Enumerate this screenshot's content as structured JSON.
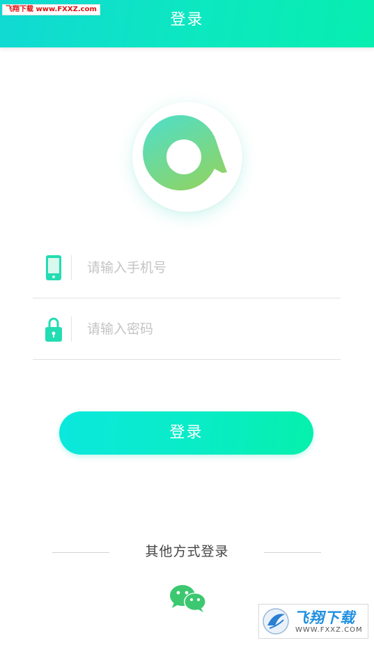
{
  "header": {
    "title": "登录"
  },
  "watermark_top": "飞翔下载 www.FXXZ.com",
  "form": {
    "phone": {
      "icon": "phone-icon",
      "placeholder": "请输入手机号",
      "value": ""
    },
    "password": {
      "icon": "lock-icon",
      "placeholder": "请输入密码",
      "value": ""
    }
  },
  "login_button": {
    "label": "登录"
  },
  "other_login": {
    "title": "其他方式登录",
    "options": [
      {
        "icon": "wechat-icon"
      }
    ]
  },
  "watermark_bottom": {
    "brand": "飞翔下载",
    "url": "WWW.FXXZ.COM"
  },
  "colors": {
    "accent": "#0ce8bf",
    "accent_start": "#11d9d3",
    "accent_end": "#06f0ac",
    "logo_ring_top": "#52dfc8",
    "logo_ring_bottom": "#86d56c",
    "wechat_green": "#3cc870",
    "placeholder": "#c4c4c4",
    "divider": "#e1e1e1"
  }
}
